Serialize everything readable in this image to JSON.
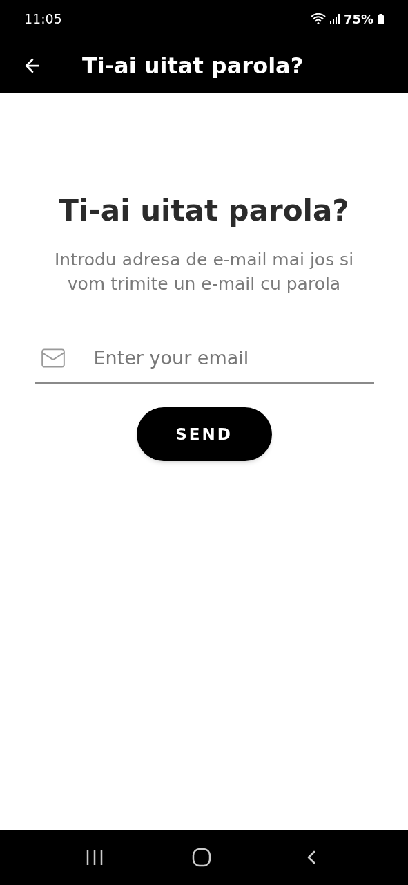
{
  "status_bar": {
    "time": "11:05",
    "battery": "75%"
  },
  "app_bar": {
    "title": "Ti-ai uitat parola?"
  },
  "heading": "Ti-ai uitat parola?",
  "description": "Introdu adresa de e-mail mai jos si vom trimite un e-mail cu parola",
  "email_field": {
    "placeholder": "Enter your email"
  },
  "send_button": {
    "label": "SEND"
  }
}
